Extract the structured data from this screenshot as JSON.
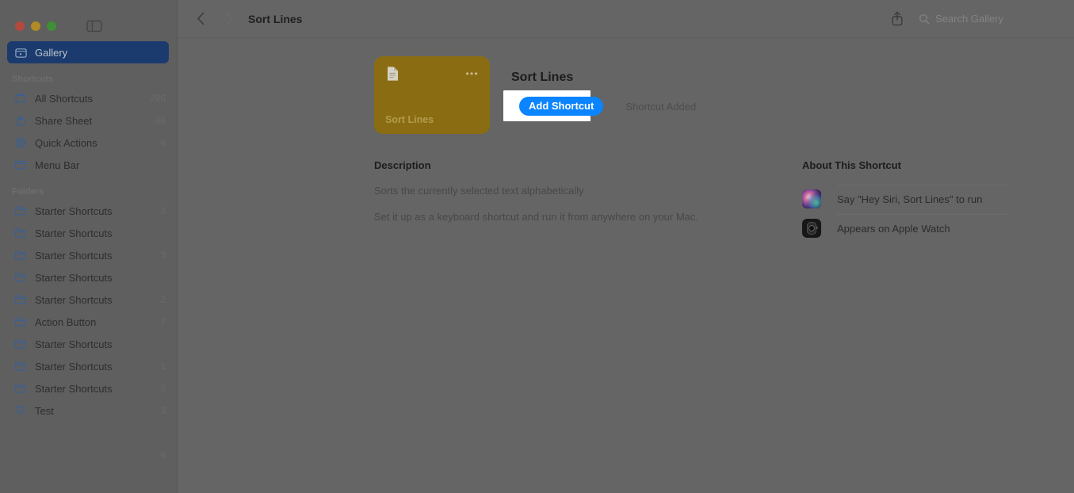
{
  "window": {
    "traffic_lights": [
      "close",
      "minimize",
      "zoom"
    ],
    "sidebar_toggle_icon": "sidebar-toggle-icon"
  },
  "titlebar": {
    "back_icon": "chevron-left-icon",
    "forward_icon": "chevron-right-icon",
    "breadcrumb": "Sort Lines",
    "share_icon": "share-icon",
    "search_icon": "search-icon",
    "search_placeholder": "Search Gallery",
    "search_value": ""
  },
  "sidebar": {
    "selected": {
      "label": "Gallery",
      "icon": "gallery-icon"
    },
    "shortcuts_header": "Shortcuts",
    "shortcuts": [
      {
        "label": "All Shortcuts",
        "count": "296",
        "icon": "all-shortcuts-icon"
      },
      {
        "label": "Share Sheet",
        "count": "86",
        "icon": "share-sheet-icon"
      },
      {
        "label": "Quick Actions",
        "count": "6",
        "icon": "quick-actions-icon"
      },
      {
        "label": "Menu Bar",
        "count": "",
        "icon": "menu-bar-icon"
      }
    ],
    "folders_header": "Folders",
    "folders": [
      {
        "label": "Starter Shortcuts",
        "count": "3",
        "icon": "folder-icon"
      },
      {
        "label": "Starter Shortcuts",
        "count": "",
        "icon": "folder-icon"
      },
      {
        "label": "Starter Shortcuts",
        "count": "3",
        "icon": "folder-icon"
      },
      {
        "label": "Starter Shortcuts",
        "count": "",
        "icon": "folder-icon"
      },
      {
        "label": "Starter Shortcuts",
        "count": "2",
        "icon": "folder-icon"
      },
      {
        "label": "Action Button",
        "count": "7",
        "icon": "folder-icon"
      },
      {
        "label": "Starter Shortcuts",
        "count": "",
        "icon": "folder-icon"
      },
      {
        "label": "Starter Shortcuts",
        "count": "1",
        "icon": "folder-icon"
      },
      {
        "label": "Starter Shortcuts",
        "count": "3",
        "icon": "folder-icon"
      },
      {
        "label": "Test",
        "count": "3",
        "icon": "puzzle-icon"
      }
    ],
    "orphan_count": "6"
  },
  "hero": {
    "card": {
      "name": "Sort Lines",
      "glyph_icon": "document-icon",
      "menu_icon": "ellipsis-icon",
      "color": "#8a6d12"
    },
    "title": "Sort Lines",
    "add_button": "Add Shortcut",
    "added_label": "Shortcut Added",
    "accent_color": "#0a84ff",
    "highlight_color": "#ffffff"
  },
  "description": {
    "heading": "Description",
    "paragraphs": [
      "Sorts the currently selected text alphabetically",
      "Set it up as a keyboard shortcut and run it from anywhere on your Mac."
    ]
  },
  "about": {
    "heading": "About This Shortcut",
    "rows": [
      {
        "label": "Say \"Hey Siri, Sort Lines\" to run",
        "icon": "siri-icon"
      },
      {
        "label": "Appears on Apple Watch",
        "icon": "apple-watch-icon"
      }
    ]
  }
}
